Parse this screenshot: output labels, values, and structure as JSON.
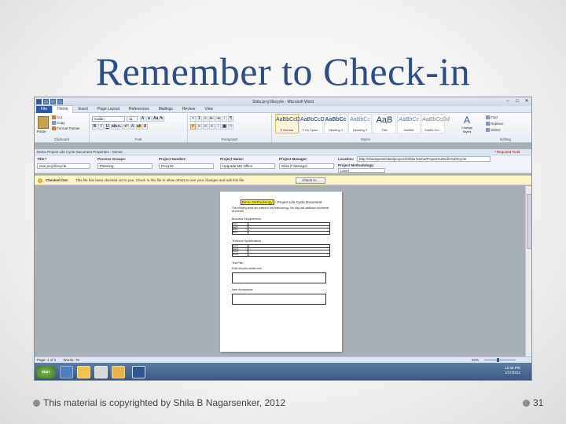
{
  "slide": {
    "title": "Remember to Check-in",
    "footer": "This material is copyrighted by Shila B Nagarsenker, 2012",
    "page_number": "31"
  },
  "window": {
    "title": "Shila proj lifecycle - Microsoft Word",
    "controls": [
      "–",
      "□",
      "✕"
    ]
  },
  "ribbon": {
    "tabs": [
      "File",
      "Home",
      "Insert",
      "Page Layout",
      "References",
      "Mailings",
      "Review",
      "View"
    ],
    "active_tab": "Home",
    "clipboard": {
      "paste": "Paste",
      "cut": "Cut",
      "copy": "Copy",
      "format_painter": "Format Painter",
      "label": "Clipboard"
    },
    "font": {
      "name": "Calibri",
      "size": "11",
      "label": "Font"
    },
    "paragraph": {
      "label": "Paragraph"
    },
    "styles": {
      "label": "Styles",
      "items": [
        {
          "preview": "AaBbCcDd",
          "name": "¶ Normal"
        },
        {
          "preview": "AaBbCcDd",
          "name": "¶ No Spaci..."
        },
        {
          "preview": "AaBbCc",
          "name": "Heading 1"
        },
        {
          "preview": "AaBbCc",
          "name": "Heading 2"
        },
        {
          "preview": "AaB",
          "name": "Title"
        },
        {
          "preview": "AaBbCc",
          "name": "Subtitle"
        },
        {
          "preview": "AaBbCcDd",
          "name": "Subtle Em..."
        }
      ],
      "change_styles": "Change Styles"
    },
    "editing": {
      "find": "Find",
      "replace": "Replace",
      "select": "Select",
      "label": "Editing"
    }
  },
  "doc_properties": {
    "header": "Demo Project Life Cycle Document Properties - Server",
    "location_label": "Location:",
    "location_value": "http://sharepoint/sites/projects/Shila Demo/Project%20Life%20Cycle",
    "required_field": "* Required Field",
    "fields": [
      {
        "label": "Title:",
        "value": "new proj lifecycle"
      },
      {
        "label": "Process Groups:",
        "value": "Planning"
      },
      {
        "label": "Project Number:",
        "value": "Proj123"
      },
      {
        "label": "Project Name:",
        "value": "Upgrade MS Office"
      },
      {
        "label": "Project Manager:",
        "value": "Shila P Manager"
      },
      {
        "label": "Project Methodology:",
        "value": "Level"
      }
    ]
  },
  "checkout_bar": {
    "label": "Checked Out",
    "message": "This file has been checked out to you. Check in this file to allow others to see your changes and edit this file.",
    "button": "Check In..."
  },
  "document": {
    "heading_highlight": "Demo Methodology",
    "heading_rest": " - Project Life Cycle Document",
    "intro": "The following areas are related to this Methodology. You may add additional documents as needed.",
    "section1": "Business Requirements",
    "table1_rows": [
      "Item1",
      "Item2",
      "Item3",
      "Item4"
    ],
    "section2": "Technical Specifications",
    "table2_rows": [
      "Spec1",
      "Spec2",
      "Spec3",
      "Spec4"
    ],
    "section3": "Test Plan",
    "section3_text": "Enter test plan details here",
    "section4": "User Acceptance"
  },
  "status_bar": {
    "page": "Page: 1 of 2",
    "words": "Words: 76",
    "zoom": "92%"
  },
  "taskbar": {
    "start": "Start",
    "time": "12:36 PM",
    "date": "1/27/2012"
  }
}
